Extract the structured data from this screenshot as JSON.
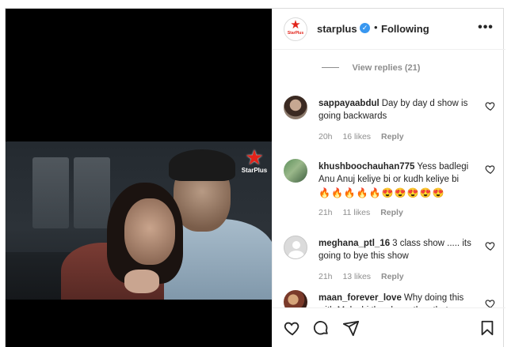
{
  "post": {
    "username": "starplus",
    "follow_status": "Following",
    "separator": "•",
    "more_label": "•••",
    "watermark": "StarPlus",
    "avatar_text": "StarPlus"
  },
  "view_replies": "View replies (21)",
  "comments": [
    {
      "username": "sappayaabdul",
      "text": "Day by day d show is going backwards",
      "emoji": "",
      "time": "20h",
      "likes": "16 likes",
      "reply": "Reply"
    },
    {
      "username": "khushboochauhan775",
      "text": "Yess badlegi Anu Anuj keliye bi or kudh keliye bi",
      "emoji": "🔥🔥🔥🔥🔥😍😍😍😍😍",
      "time": "21h",
      "likes": "11 likes",
      "reply": "Reply"
    },
    {
      "username": "meghana_ptl_16",
      "text": "3 class show ..... its going to bye this show",
      "emoji": "",
      "time": "21h",
      "likes": "13 likes",
      "reply": "Reply"
    },
    {
      "username": "maan_forever_love",
      "text": "Why doing this with Maleshi they have they that",
      "emoji": "",
      "time": "",
      "likes": "",
      "reply": ""
    }
  ],
  "icons": {
    "heart": "heart-icon",
    "comment": "comment-icon",
    "bookmark": "bookmark-icon",
    "verified": "verified-badge-icon",
    "more": "more-options-icon"
  },
  "colors": {
    "verified": "#3897f0",
    "brand_red": "#e2231a",
    "muted": "#8e8e8e",
    "text": "#262626"
  }
}
